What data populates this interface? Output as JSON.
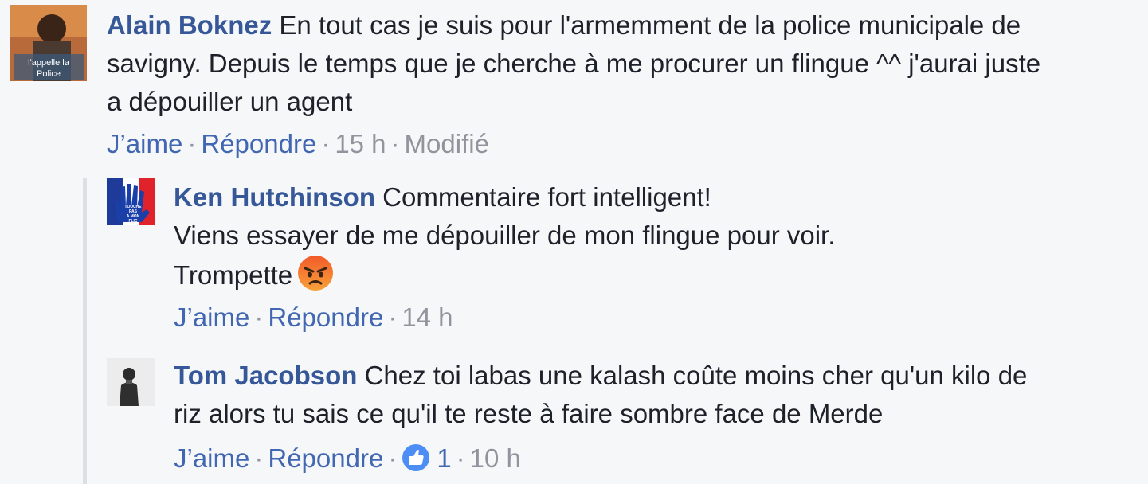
{
  "comments": [
    {
      "author": "Alain Boknez",
      "text_line1": "En tout cas je suis pour l'armemment de la police municipale de",
      "text_line2": "savigny. Depuis le temps que je cherche à me procurer un flingue ^^ j'aurai juste",
      "text_line3": "a dépouiller un agent",
      "avatar_caption1": "l'appelle la",
      "avatar_caption2": "Police",
      "like_label": "J’aime",
      "reply_label": "Répondre",
      "time": "15 h",
      "edited_label": "Modifié"
    },
    {
      "author": "Ken Hutchinson",
      "text_line1": "Commentaire fort intelligent!",
      "text_line2": "Viens essayer de me dépouiller de mon flingue pour voir.",
      "text_line3": "Trompette",
      "emoji": "angry-face-icon",
      "avatar_text1": "TOUCHE",
      "avatar_text2": "PAS",
      "avatar_text3": "A MON",
      "avatar_text4": "FLIC",
      "like_label": "J’aime",
      "reply_label": "Répondre",
      "time": "14 h"
    },
    {
      "author": "Tom Jacobson",
      "text_line1": "Chez toi labas une kalash coûte moins cher qu'un kilo de",
      "text_line2": "riz alors tu sais ce qu'il te reste à faire sombre face de Merde",
      "like_label": "J’aime",
      "reply_label": "Répondre",
      "reaction_count": "1",
      "time": "10 h"
    }
  ],
  "separator": "·",
  "colors": {
    "author": "#365899",
    "link": "#4267b2",
    "meta": "#90949c",
    "background": "#f6f7f9",
    "like_badge": "#4c8df6"
  }
}
